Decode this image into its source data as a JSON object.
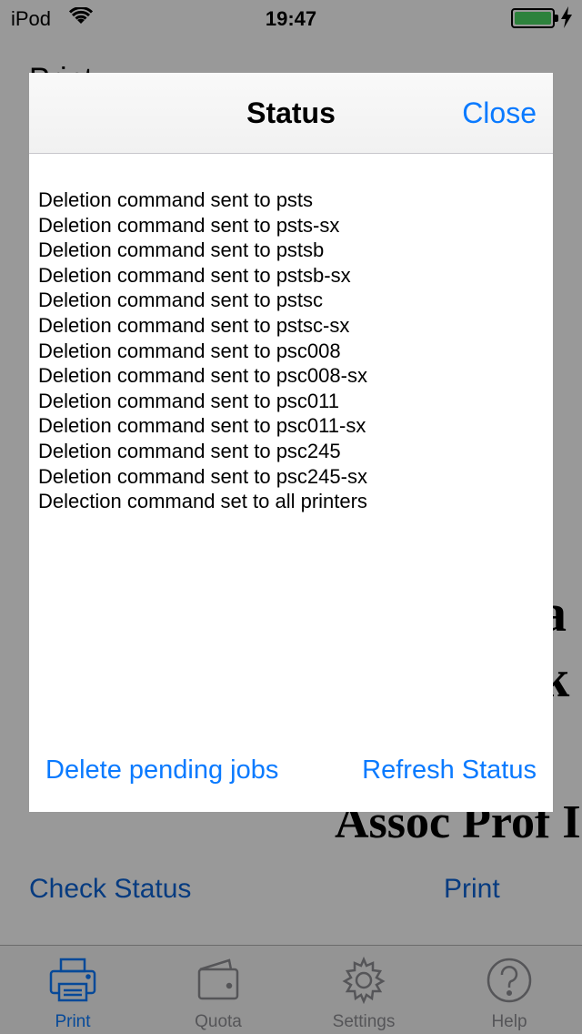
{
  "status_bar": {
    "carrier": "iPod",
    "time": "19:47"
  },
  "background": {
    "app_title": "Print",
    "doc_fragments": [
      "a",
      "k",
      "Assoc Prof I"
    ],
    "check_status_label": "Check Status",
    "print_label": "Print"
  },
  "tab_bar": {
    "items": [
      {
        "label": "Print",
        "icon": "printer-icon",
        "active": true
      },
      {
        "label": "Quota",
        "icon": "wallet-icon",
        "active": false
      },
      {
        "label": "Settings",
        "icon": "gear-icon",
        "active": false
      },
      {
        "label": "Help",
        "icon": "question-icon",
        "active": false
      }
    ]
  },
  "modal": {
    "title": "Status",
    "close_label": "Close",
    "log_lines": [
      "Deletion command sent to psts",
      "Deletion command sent to psts-sx",
      "Deletion command sent to pstsb",
      "Deletion command sent to pstsb-sx",
      "Deletion command sent to pstsc",
      "Deletion command sent to pstsc-sx",
      "Deletion command sent to psc008",
      "Deletion command sent to psc008-sx",
      "Deletion command sent to psc011",
      "Deletion command sent to psc011-sx",
      "Deletion command sent to psc245",
      "Deletion command sent to psc245-sx",
      "Delection command set to all printers"
    ],
    "delete_label": "Delete pending jobs",
    "refresh_label": "Refresh Status"
  },
  "colors": {
    "accent": "#0a7aff",
    "battery": "#4cd964",
    "dim": "rgba(0,0,0,0.40)"
  }
}
